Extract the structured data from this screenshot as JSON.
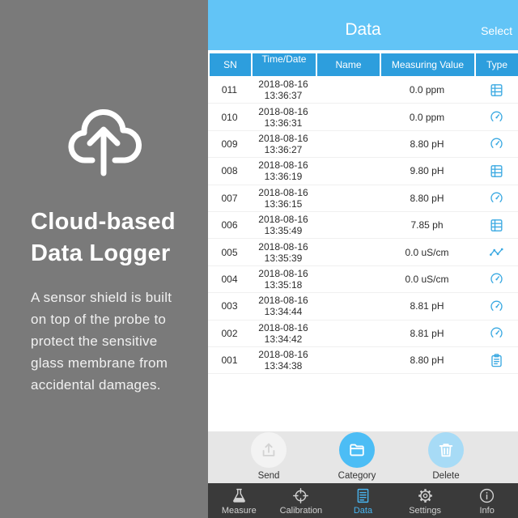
{
  "promo": {
    "icon": "cloud-upload-icon",
    "title_lines": [
      "Cloud-based",
      "Data Logger"
    ],
    "description_lines": [
      "A sensor shield is built",
      "on top of the probe to",
      "protect the sensitive",
      "glass membrane from",
      "accidental damages."
    ]
  },
  "app": {
    "header": {
      "title": "Data",
      "select_label": "Select"
    },
    "table": {
      "columns": [
        "SN",
        "Time/Date",
        "Name",
        "Measuring Value",
        "Type"
      ],
      "rows": [
        {
          "sn": "011",
          "date": "2018-08-16",
          "time": "13:36:37",
          "name": "",
          "value": "0.0 ppm",
          "type_icon": "table-icon"
        },
        {
          "sn": "010",
          "date": "2018-08-16",
          "time": "13:36:31",
          "name": "",
          "value": "0.0 ppm",
          "type_icon": "gauge-icon"
        },
        {
          "sn": "009",
          "date": "2018-08-16",
          "time": "13:36:27",
          "name": "",
          "value": "8.80 pH",
          "type_icon": "gauge-icon"
        },
        {
          "sn": "008",
          "date": "2018-08-16",
          "time": "13:36:19",
          "name": "",
          "value": "9.80 pH",
          "type_icon": "table-icon"
        },
        {
          "sn": "007",
          "date": "2018-08-16",
          "time": "13:36:15",
          "name": "",
          "value": "8.80 pH",
          "type_icon": "gauge-icon"
        },
        {
          "sn": "006",
          "date": "2018-08-16",
          "time": "13:35:49",
          "name": "",
          "value": "7.85 ph",
          "type_icon": "table-icon"
        },
        {
          "sn": "005",
          "date": "2018-08-16",
          "time": "13:35:39",
          "name": "",
          "value": "0.0 uS/cm",
          "type_icon": "line-chart-icon"
        },
        {
          "sn": "004",
          "date": "2018-08-16",
          "time": "13:35:18",
          "name": "",
          "value": "0.0 uS/cm",
          "type_icon": "gauge-icon"
        },
        {
          "sn": "003",
          "date": "2018-08-16",
          "time": "13:34:44",
          "name": "",
          "value": "8.81 pH",
          "type_icon": "gauge-icon"
        },
        {
          "sn": "002",
          "date": "2018-08-16",
          "time": "13:34:42",
          "name": "",
          "value": "8.81 pH",
          "type_icon": "gauge-icon"
        },
        {
          "sn": "001",
          "date": "2018-08-16",
          "time": "13:34:38",
          "name": "",
          "value": "8.80 pH",
          "type_icon": "clipboard-icon"
        }
      ]
    },
    "actions": [
      {
        "label": "Send",
        "icon": "upload-icon",
        "enabled": false,
        "circle_color": "#f3f3f3",
        "icon_color": "#d3d3d3"
      },
      {
        "label": "Category",
        "icon": "folder-icon",
        "enabled": true,
        "circle_color": "#4cbdf5",
        "icon_color": "#ffffff"
      },
      {
        "label": "Delete",
        "icon": "trash-icon",
        "enabled": true,
        "circle_color": "#a7dbf6",
        "icon_color": "#ffffff"
      }
    ],
    "tabs": [
      {
        "label": "Measure",
        "icon": "flask-icon",
        "active": false
      },
      {
        "label": "Calibration",
        "icon": "crosshair-icon",
        "active": false
      },
      {
        "label": "Data",
        "icon": "list-icon",
        "active": true
      },
      {
        "label": "Settings",
        "icon": "gear-icon",
        "active": false
      },
      {
        "label": "Info",
        "icon": "info-icon",
        "active": false
      }
    ]
  },
  "colors": {
    "panel_bg": "#7a7a7a",
    "header_bg": "#62c4f6",
    "table_header_bg": "#2d9edd",
    "type_icon": "#3aa9e2",
    "action_bar_bg": "#e6e6e6",
    "tab_bar_bg": "#3a3a3a",
    "tab_active": "#47b4f0",
    "tab_inactive": "#d2d2d2"
  }
}
